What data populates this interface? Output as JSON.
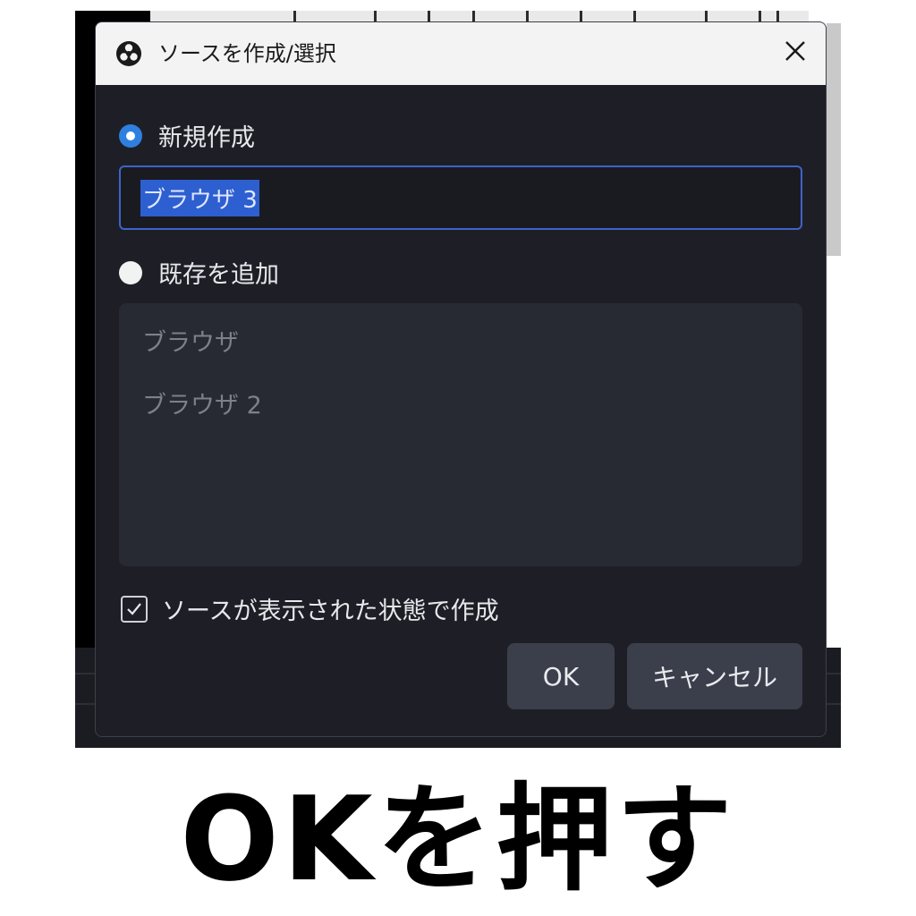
{
  "dialog": {
    "title": "ソースを作成/選択",
    "close_label": "×"
  },
  "create_new": {
    "label": "新規作成",
    "selected": true,
    "input_value": "ブラウザ 3"
  },
  "add_existing": {
    "label": "既存を追加",
    "selected": false,
    "items": [
      "ブラウザ",
      "ブラウザ 2"
    ]
  },
  "visible_option": {
    "label": "ソースが表示された状態で作成",
    "checked": true
  },
  "buttons": {
    "ok": "OK",
    "cancel": "キャンセル"
  },
  "caption": "OKを押す",
  "colors": {
    "dialog_bg": "#1e1f26",
    "accent": "#2f7fe0",
    "input_border": "#3e63c9",
    "button_bg": "#3b3f4b"
  }
}
